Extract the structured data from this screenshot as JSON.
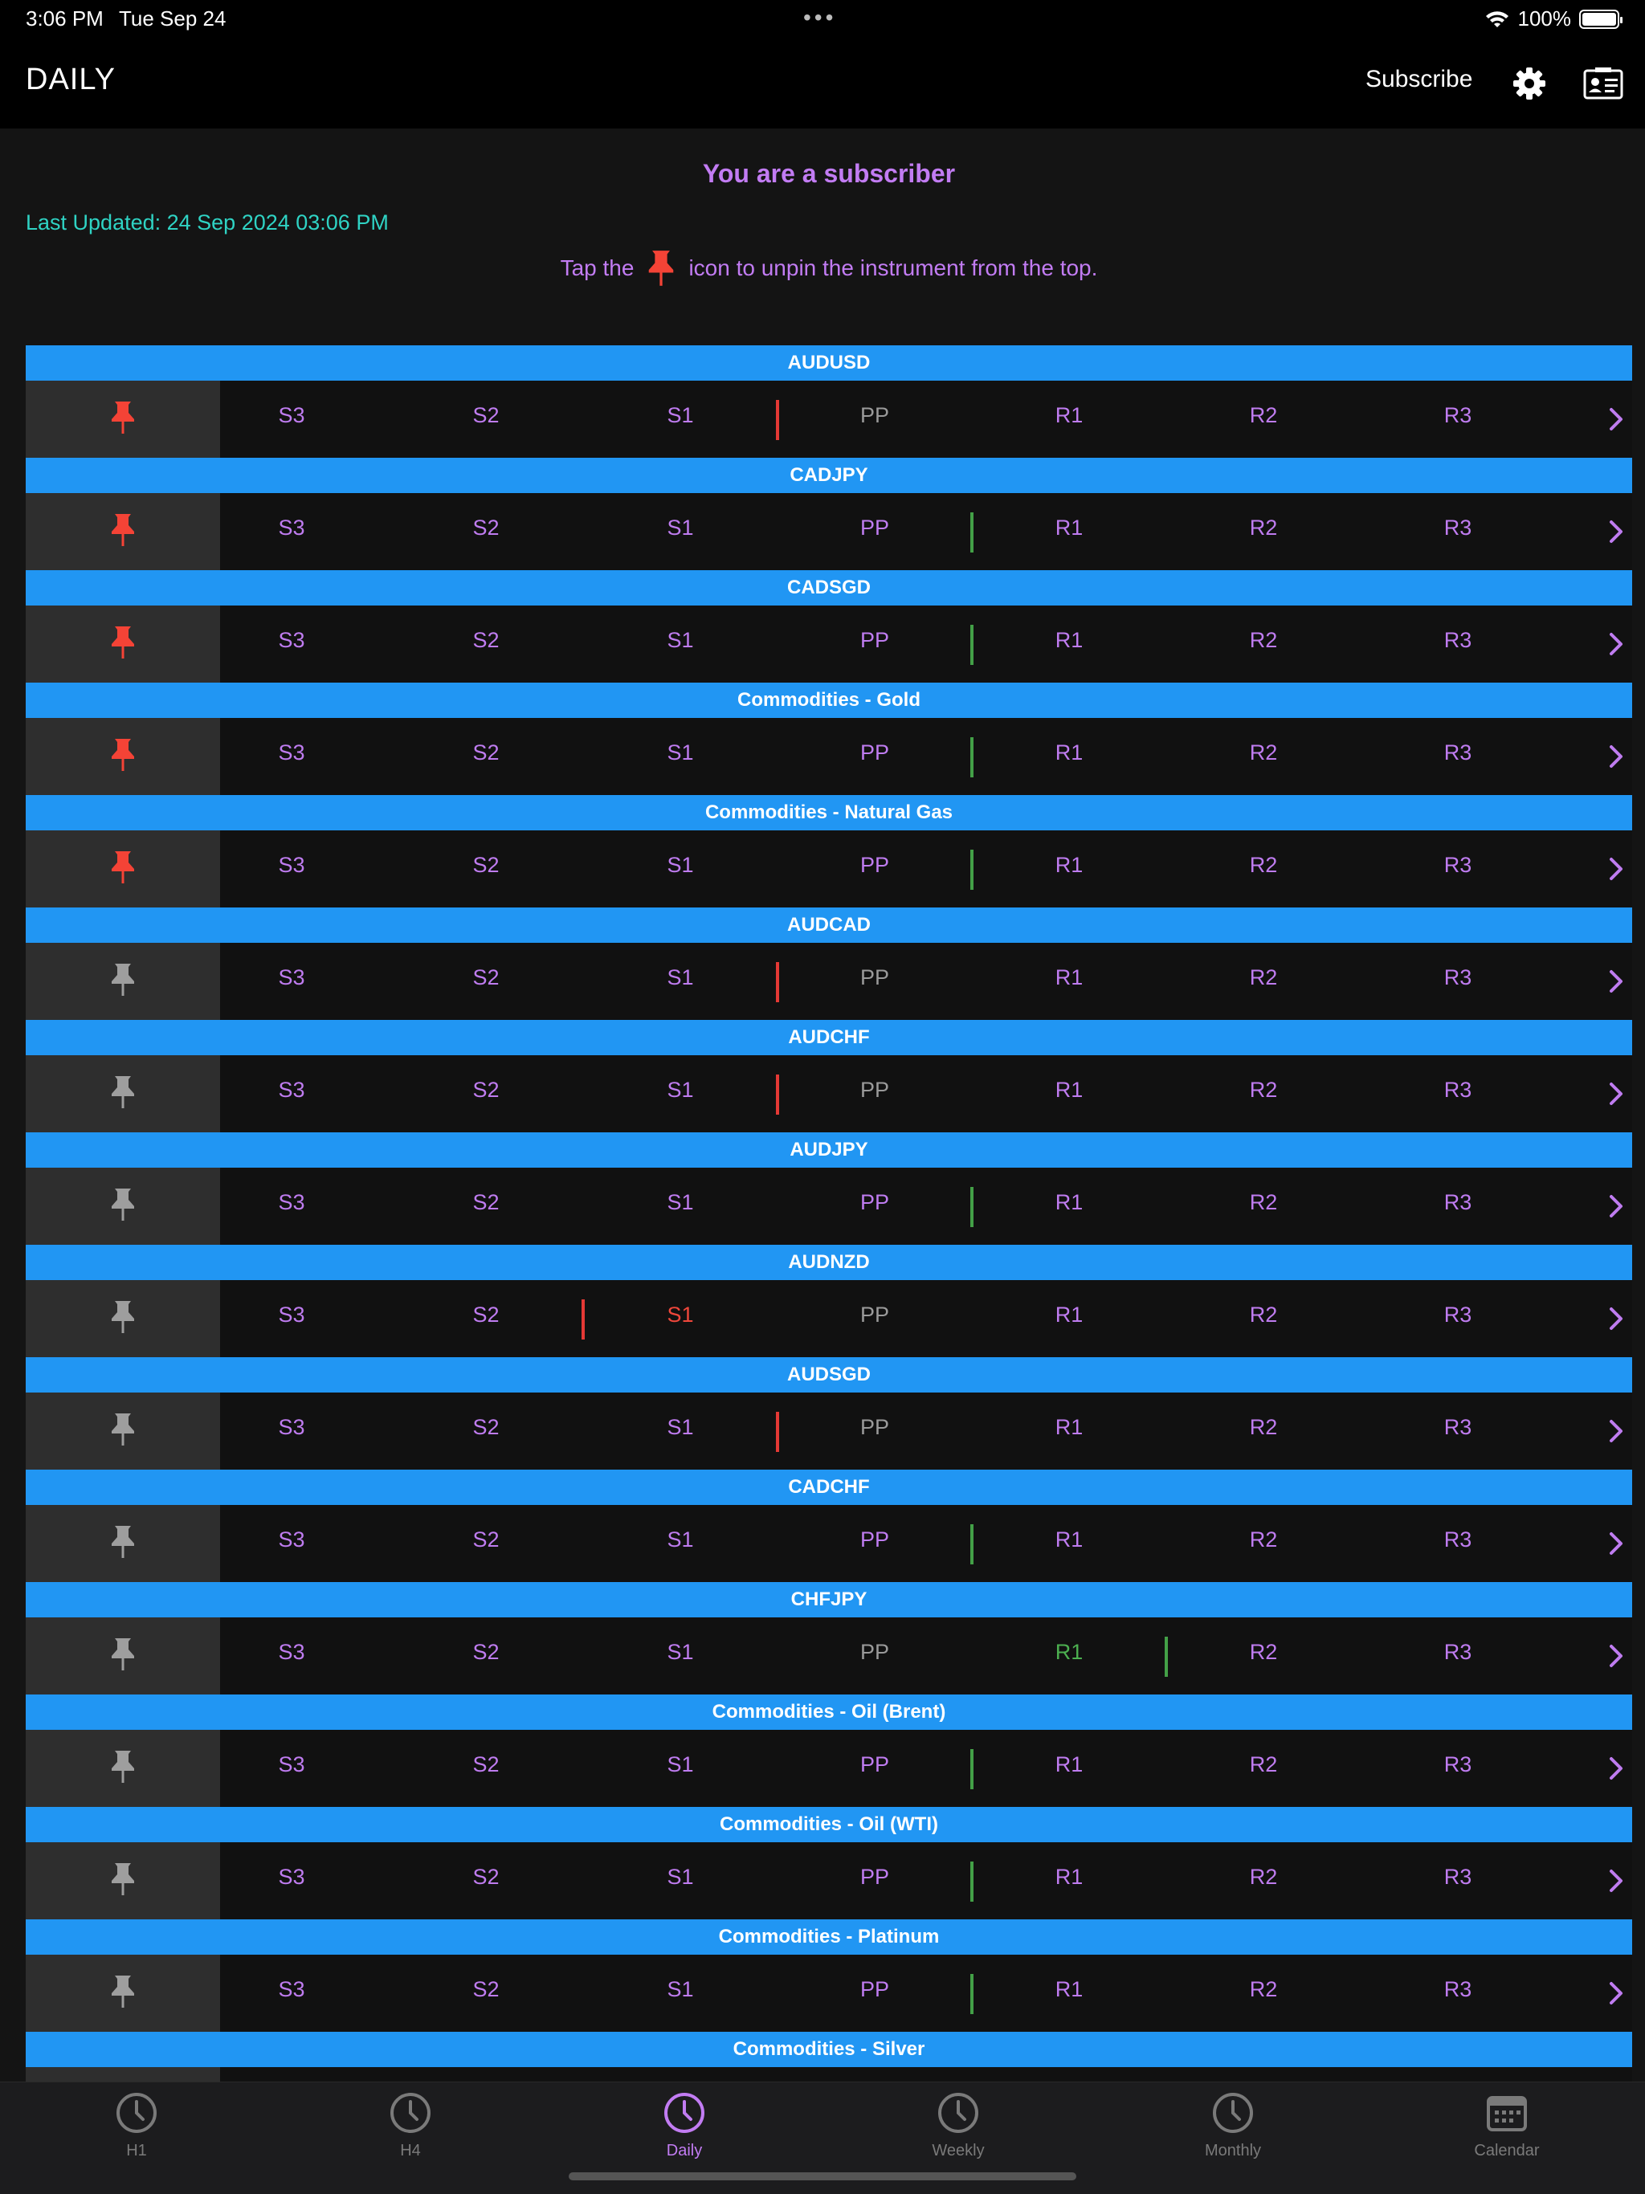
{
  "status": {
    "time": "3:06 PM",
    "date": "Tue Sep 24",
    "battery": "100%",
    "battery_level": 1.0
  },
  "nav": {
    "title": "DAILY",
    "subscribe_label": "Subscribe"
  },
  "header": {
    "subscriber_msg": "You are a subscriber",
    "last_updated": "Last Updated: 24 Sep 2024 03:06 PM",
    "hint_before": "Tap the",
    "hint_after": "icon to unpin the instrument from the top."
  },
  "colors": {
    "accent": "#c27cf3",
    "header_bar": "#2196f3",
    "pinned": "#f44336",
    "unpinned": "#9e9e9e",
    "up": "#43a047",
    "down": "#e53935",
    "teal": "#2fd3c4"
  },
  "level_labels": [
    "S3",
    "S2",
    "S1",
    "PP",
    "R1",
    "R2",
    "R3"
  ],
  "instruments": [
    {
      "name": "AUDUSD",
      "pinned": true,
      "divider_after": 2,
      "divider_color": "red",
      "highlight": null,
      "highlight_color": null
    },
    {
      "name": "CADJPY",
      "pinned": true,
      "divider_after": 3,
      "divider_color": "green",
      "highlight": null,
      "highlight_color": null
    },
    {
      "name": "CADSGD",
      "pinned": true,
      "divider_after": 3,
      "divider_color": "green",
      "highlight": null,
      "highlight_color": null
    },
    {
      "name": "Commodities - Gold",
      "pinned": true,
      "divider_after": 3,
      "divider_color": "green",
      "highlight": null,
      "highlight_color": null
    },
    {
      "name": "Commodities - Natural Gas",
      "pinned": true,
      "divider_after": 3,
      "divider_color": "green",
      "highlight": null,
      "highlight_color": null
    },
    {
      "name": "AUDCAD",
      "pinned": false,
      "divider_after": 2,
      "divider_color": "red",
      "highlight": null,
      "highlight_color": null
    },
    {
      "name": "AUDCHF",
      "pinned": false,
      "divider_after": 2,
      "divider_color": "red",
      "highlight": null,
      "highlight_color": null
    },
    {
      "name": "AUDJPY",
      "pinned": false,
      "divider_after": 3,
      "divider_color": "green",
      "highlight": null,
      "highlight_color": null
    },
    {
      "name": "AUDNZD",
      "pinned": false,
      "divider_after": 1,
      "divider_color": "red",
      "highlight": 2,
      "highlight_color": "red"
    },
    {
      "name": "AUDSGD",
      "pinned": false,
      "divider_after": 2,
      "divider_color": "red",
      "highlight": null,
      "highlight_color": null
    },
    {
      "name": "CADCHF",
      "pinned": false,
      "divider_after": 3,
      "divider_color": "green",
      "highlight": null,
      "highlight_color": null
    },
    {
      "name": "CHFJPY",
      "pinned": false,
      "divider_after": 4,
      "divider_color": "green",
      "highlight": 4,
      "highlight_color": "green"
    },
    {
      "name": "Commodities - Oil (Brent)",
      "pinned": false,
      "divider_after": 3,
      "divider_color": "green",
      "highlight": null,
      "highlight_color": null
    },
    {
      "name": "Commodities - Oil (WTI)",
      "pinned": false,
      "divider_after": 3,
      "divider_color": "green",
      "highlight": null,
      "highlight_color": null
    },
    {
      "name": "Commodities - Platinum",
      "pinned": false,
      "divider_after": 3,
      "divider_color": "green",
      "highlight": null,
      "highlight_color": null
    },
    {
      "name": "Commodities - Silver",
      "pinned": false,
      "divider_after": null,
      "divider_color": null,
      "highlight": null,
      "highlight_color": null
    }
  ],
  "tabs": [
    {
      "label": "H1",
      "icon": "clock-icon",
      "active": false
    },
    {
      "label": "H4",
      "icon": "clock-icon",
      "active": false
    },
    {
      "label": "Daily",
      "icon": "clock-icon",
      "active": true
    },
    {
      "label": "Weekly",
      "icon": "clock-icon",
      "active": false
    },
    {
      "label": "Monthly",
      "icon": "clock-icon",
      "active": false
    },
    {
      "label": "Calendar",
      "icon": "calendar-icon",
      "active": false
    }
  ]
}
